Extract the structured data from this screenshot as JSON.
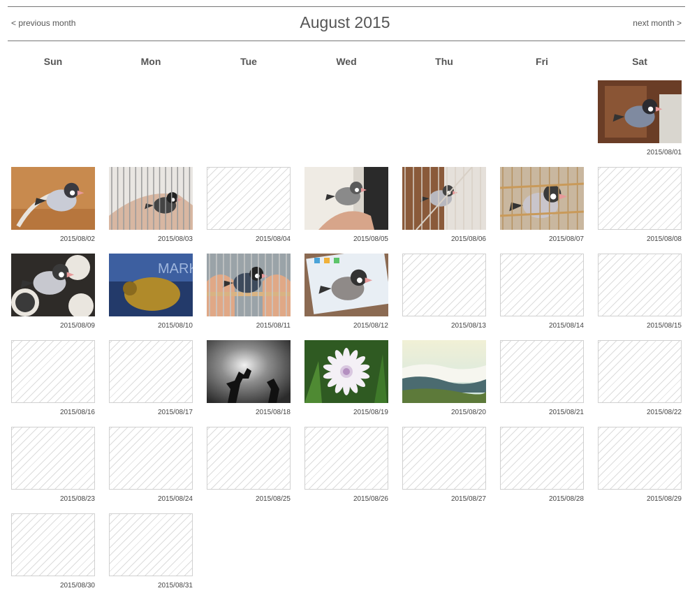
{
  "header": {
    "prev_label": "< previous month",
    "title": "August 2015",
    "next_label": "next month >"
  },
  "weekdays": [
    "Sun",
    "Mon",
    "Tue",
    "Wed",
    "Thu",
    "Fri",
    "Sat"
  ],
  "days": [
    {
      "date": "2015/08/01",
      "photo": "bird-on-chair"
    },
    {
      "date": "2015/08/02",
      "photo": "bird-with-feather"
    },
    {
      "date": "2015/08/03",
      "photo": "bird-on-arm-in-cage"
    },
    {
      "date": "2015/08/04",
      "photo": null
    },
    {
      "date": "2015/08/05",
      "photo": "bird-on-hand-with-book"
    },
    {
      "date": "2015/08/06",
      "photo": "bird-in-cage"
    },
    {
      "date": "2015/08/07",
      "photo": "bird-closeup-in-cage"
    },
    {
      "date": "2015/08/08",
      "photo": null
    },
    {
      "date": "2015/08/09",
      "photo": "bird-on-plates"
    },
    {
      "date": "2015/08/10",
      "photo": "bird-on-screen"
    },
    {
      "date": "2015/08/11",
      "photo": "bird-on-perch-with-hands"
    },
    {
      "date": "2015/08/12",
      "photo": "bird-on-tablet"
    },
    {
      "date": "2015/08/13",
      "photo": null
    },
    {
      "date": "2015/08/14",
      "photo": null
    },
    {
      "date": "2015/08/15",
      "photo": null
    },
    {
      "date": "2015/08/16",
      "photo": null
    },
    {
      "date": "2015/08/17",
      "photo": null
    },
    {
      "date": "2015/08/18",
      "photo": "silhouette-statues-sky"
    },
    {
      "date": "2015/08/19",
      "photo": "white-flower"
    },
    {
      "date": "2015/08/20",
      "photo": "sea-of-clouds"
    },
    {
      "date": "2015/08/21",
      "photo": null
    },
    {
      "date": "2015/08/22",
      "photo": null
    },
    {
      "date": "2015/08/23",
      "photo": null
    },
    {
      "date": "2015/08/24",
      "photo": null
    },
    {
      "date": "2015/08/25",
      "photo": null
    },
    {
      "date": "2015/08/26",
      "photo": null
    },
    {
      "date": "2015/08/27",
      "photo": null
    },
    {
      "date": "2015/08/28",
      "photo": null
    },
    {
      "date": "2015/08/29",
      "photo": null
    },
    {
      "date": "2015/08/30",
      "photo": null
    },
    {
      "date": "2015/08/31",
      "photo": null
    }
  ]
}
